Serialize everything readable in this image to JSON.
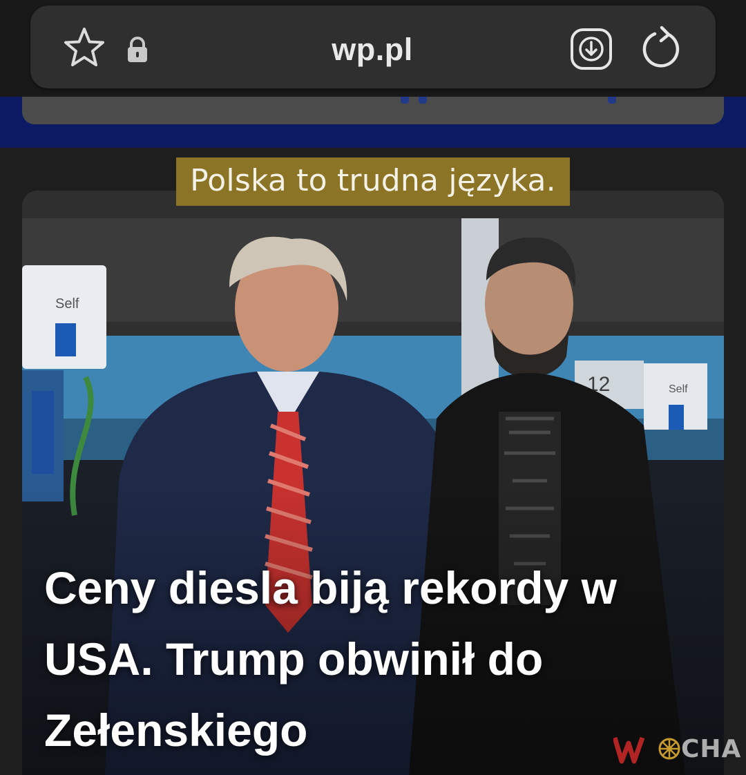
{
  "browser": {
    "url": "wp.pl",
    "icons": {
      "bookmark": "star-icon",
      "secure": "lock-icon",
      "download": "download-icon",
      "reload": "reload-icon"
    }
  },
  "post": {
    "caption": "Polska to trudna języka.",
    "headline_lines": [
      "Ceny diesla biją rekordy w",
      "USA. Trump obwinił do",
      "Zełenskiego"
    ],
    "watermark": "WIOCHA",
    "watermark_tail": "IOCHA"
  },
  "colors": {
    "page_bg": "#1e1e1e",
    "address_bar": "#2f2f2f",
    "navy_strip": "#0b1a63",
    "caption_bg": "#8c7426",
    "watermark_red": "#b22424"
  }
}
